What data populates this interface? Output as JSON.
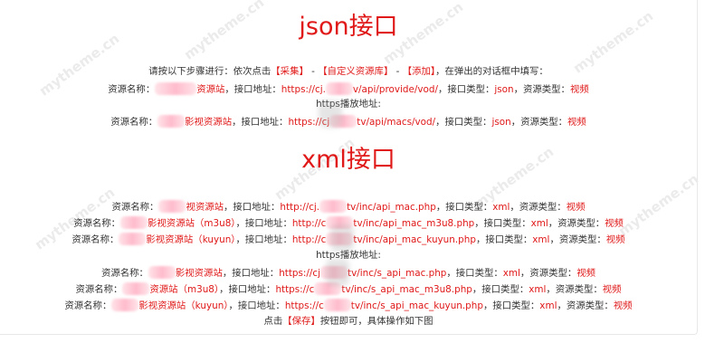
{
  "watermark": "mytheme.cn",
  "json_section": {
    "title": "json接口",
    "intro_1": "请按以下步骤进行：依次点击",
    "btn_collect": "【采集】",
    "sep_1": " - ",
    "btn_custom": "【自定义资源库】",
    "sep_2": " - ",
    "btn_add": "【添加】",
    "intro_2": "，在弹出的对话框中填写：",
    "entry_1": {
      "k1": "资源名称：",
      "v1": "资源站",
      "k2": "，接口地址：",
      "v2a": "https://cj.",
      "v2b": "v/api/provide/vod/",
      "k3": "，接口类型：",
      "v3": "json",
      "k4": "，资源类型：",
      "v4": "视频"
    },
    "https_label": "https播放地址:",
    "entry_2": {
      "k1": "资源名称：",
      "v1": "影视资源站",
      "k2": "，接口地址：",
      "v2a": "https://cj",
      "v2b": "tv/api/macs/vod/",
      "k3": "，接口类型：",
      "v3": "json",
      "k4": "，资源类型：",
      "v4": "视频"
    }
  },
  "xml_section": {
    "title": "xml接口",
    "entries": [
      {
        "k1": "资源名称：",
        "v1": "视资源站",
        "k2": "，接口地址：",
        "v2a": "http://cj.",
        "v2b": "tv/inc/api_mac.php",
        "k3": "，接口类型：",
        "v3": "xml",
        "k4": "，资源类型：",
        "v4": "视频"
      },
      {
        "k1": "资源名称：",
        "v1": "影视资源站（m3u8）",
        "k2": "，接口地址：",
        "v2a": "http://c",
        "v2b": "tv/inc/api_mac_m3u8.php",
        "k3": "，接口类型：",
        "v3": "xml",
        "k4": "，资源类型：",
        "v4": "视频"
      },
      {
        "k1": "资源名称：",
        "v1": "影视资源站（kuyun）",
        "k2": "，接口地址：",
        "v2a": "http://c",
        "v2b": "tv/inc/api_mac_kuyun.php",
        "k3": "，接口类型：",
        "v3": "xml",
        "k4": "，资源类型：",
        "v4": "视频"
      }
    ],
    "https_label": "https播放地址:",
    "https_entries": [
      {
        "k1": "资源名称：",
        "v1": "影视资源站",
        "k2": "，接口地址：",
        "v2a": "https://cj",
        "v2b": "tv/inc/s_api_mac.php",
        "k3": "，接口类型：",
        "v3": "xml",
        "k4": "，资源类型：",
        "v4": "视频"
      },
      {
        "k1": "资源名称：",
        "v1": "资源站（m3u8）",
        "k2": "，接口地址：",
        "v2a": "https://c",
        "v2b": "tv/inc/s_api_mac_m3u8.php",
        "k3": "，接口类型：",
        "v3": "xml",
        "k4": "，资源类型：",
        "v4": "视频"
      },
      {
        "k1": "资源名称：",
        "v1": "影视资源站（kuyun）",
        "k2": "，接口地址：",
        "v2a": "https://c",
        "v2b": "tv/inc/s_api_mac_kuyun.php",
        "k3": "，接口类型：",
        "v3": "xml",
        "k4": "，资源类型：",
        "v4": "视频"
      }
    ],
    "footer_1": "点击",
    "btn_save": "【保存】",
    "footer_2": "按钮即可，具体操作如下图"
  }
}
